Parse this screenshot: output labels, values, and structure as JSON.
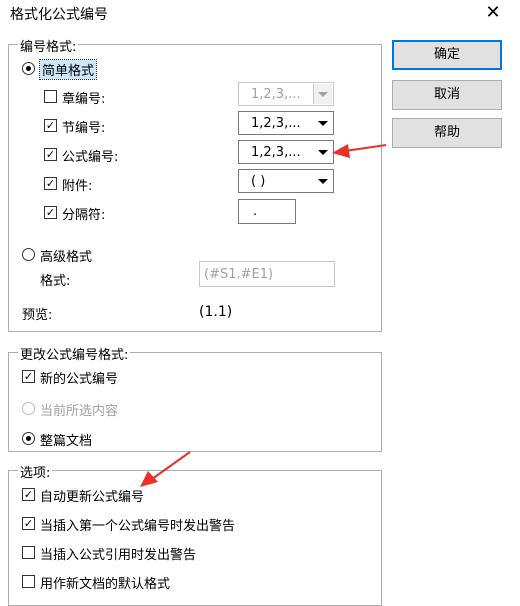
{
  "window": {
    "title": "格式化公式编号",
    "close_glyph": "✕"
  },
  "buttons": {
    "ok": "确定",
    "cancel": "取消",
    "help": "帮助"
  },
  "number_format": {
    "legend": "编号格式:",
    "simple": {
      "label": "简单格式",
      "rows": [
        {
          "label": "章编号:",
          "value": "1,2,3,..."
        },
        {
          "label": "节编号:",
          "value": "1,2,3,..."
        },
        {
          "label": "公式编号:",
          "value": "1,2,3,..."
        },
        {
          "label": "附件:",
          "value": "( )"
        },
        {
          "label": "分隔符:",
          "value": "."
        }
      ]
    },
    "advanced": {
      "label": "高级格式",
      "format_label": "格式:",
      "format_value": "(#S1.#E1)"
    },
    "preview": {
      "label": "预览:",
      "value": "(1.1)"
    }
  },
  "change_format": {
    "legend": "更改公式编号格式:",
    "new_numbers": "新的公式编号",
    "current_selection": "当前所选内容",
    "whole_document": "整篇文档"
  },
  "options": {
    "legend": "选项:",
    "items": [
      "自动更新公式编号",
      "当插入第一个公式编号时发出警告",
      "当插入公式引用时发出警告",
      "用作新文档的默认格式"
    ]
  },
  "marks": {
    "check": "✓"
  },
  "colors": {
    "arrow": "#e8302a",
    "accent": "#0078d7"
  }
}
